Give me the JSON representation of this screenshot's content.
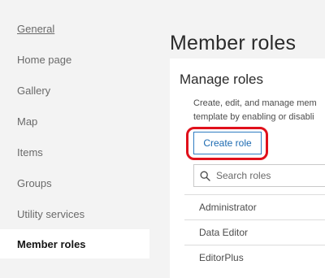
{
  "sidebar": {
    "items": [
      {
        "label": "General"
      },
      {
        "label": "Home page"
      },
      {
        "label": "Gallery"
      },
      {
        "label": "Map"
      },
      {
        "label": "Items"
      },
      {
        "label": "Groups"
      },
      {
        "label": "Utility services"
      },
      {
        "label": "Member roles"
      }
    ],
    "active_item": "Member roles"
  },
  "main": {
    "page_title": "Member roles",
    "section_title": "Manage roles",
    "description_line1": "Create, edit, and manage mem",
    "description_line2": "template by enabling or disabli",
    "create_button_label": "Create role",
    "search_placeholder": "Search roles",
    "roles": [
      "Administrator",
      "Data Editor",
      "EditorPlus"
    ]
  },
  "colors": {
    "highlight_ring": "#e0101b",
    "button_accent": "#2f7cc2"
  }
}
